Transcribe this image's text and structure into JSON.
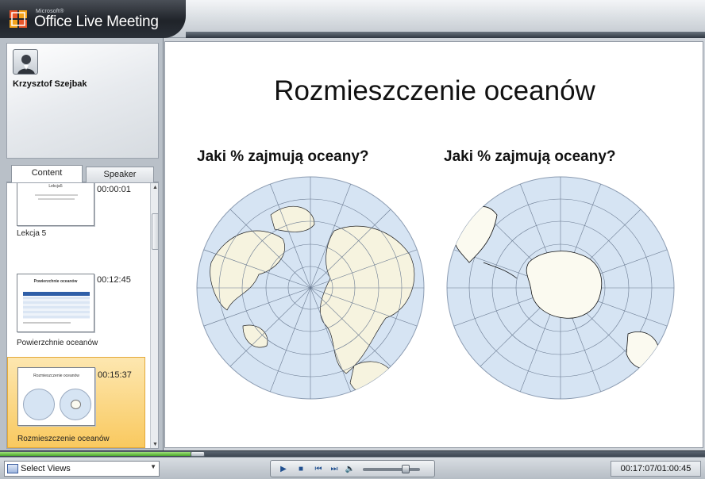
{
  "app": {
    "brand_small": "Microsoft®",
    "product": "Office Live Meeting"
  },
  "presenter": {
    "name": "Krzysztof Szejbak"
  },
  "tabs": [
    {
      "label": "Content",
      "active": true
    },
    {
      "label": "Speaker",
      "active": false
    }
  ],
  "slides": [
    {
      "label": "Lekcja 5",
      "time": "00:00:01",
      "thumb_title": "Lekcja5",
      "selected": false
    },
    {
      "label": "Powierzchnie oceanów",
      "time": "00:12:45",
      "thumb_title": "Powierzchnie oceanów",
      "selected": false
    },
    {
      "label": "Rozmieszczenie oceanów",
      "time": "00:15:37",
      "thumb_title": "Rozmieszczenie oceanów",
      "selected": true
    }
  ],
  "slide": {
    "title": "Rozmieszczenie oceanów",
    "left_question": "Jaki % zajmują oceany?",
    "right_question": "Jaki % zajmują oceany?"
  },
  "bottom": {
    "select_views": "Select Views",
    "timecode": "00:17:07/01:00:45",
    "playback_progress": 0.28,
    "volume_level": 0.75
  },
  "colors": {
    "ocean": "#d6e4f3",
    "land": "#f6f3df",
    "selected_slide": "#f9c95f",
    "progress": "#5fb83a"
  },
  "icons": [
    "play-icon",
    "stop-icon",
    "previous-icon",
    "next-icon",
    "volume-icon",
    "user-icon",
    "views-icon"
  ]
}
